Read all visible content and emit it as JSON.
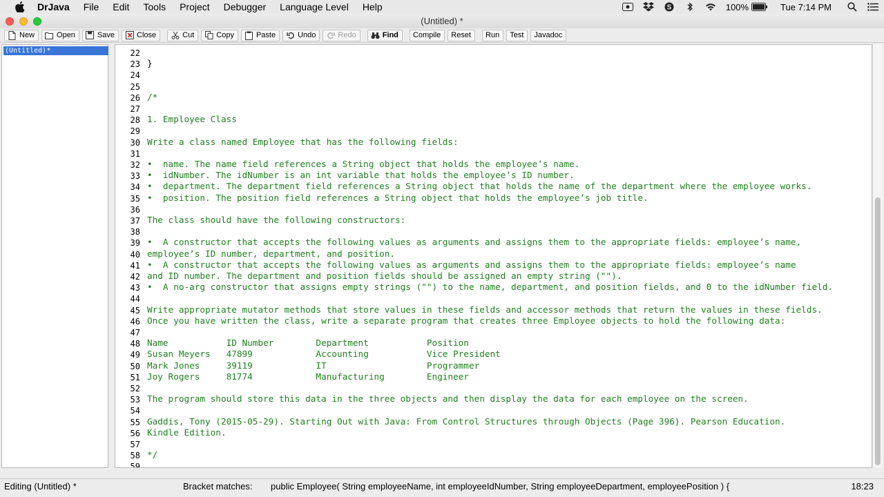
{
  "menubar": {
    "app_name": "DrJava",
    "items": [
      "File",
      "Edit",
      "Tools",
      "Project",
      "Debugger",
      "Language Level",
      "Help"
    ],
    "battery": "100%",
    "clock": "Tue 7:14 PM"
  },
  "window": {
    "title": "(Untitled) *"
  },
  "toolbar": {
    "new": "New",
    "open": "Open",
    "save": "Save",
    "close": "Close",
    "cut": "Cut",
    "copy": "Copy",
    "paste": "Paste",
    "undo": "Undo",
    "redo": "Redo",
    "find": "Find",
    "compile": "Compile",
    "reset": "Reset",
    "run": "Run",
    "test": "Test",
    "javadoc": "Javadoc"
  },
  "doclist": {
    "items": [
      "(Untitled)*"
    ]
  },
  "editor": {
    "lines": [
      {
        "n": "22",
        "t": "",
        "plain": true
      },
      {
        "n": "23",
        "t": "}",
        "plain": true
      },
      {
        "n": "24",
        "t": "",
        "plain": true
      },
      {
        "n": "25",
        "t": "",
        "plain": true
      },
      {
        "n": "26",
        "t": "/*"
      },
      {
        "n": "27",
        "t": ""
      },
      {
        "n": "28",
        "t": "1. Employee Class"
      },
      {
        "n": "29",
        "t": ""
      },
      {
        "n": "30",
        "t": "Write a class named Employee that has the following fields:"
      },
      {
        "n": "31",
        "t": ""
      },
      {
        "n": "32",
        "t": "•  name. The name field references a String object that holds the employee’s name."
      },
      {
        "n": "33",
        "t": "•  idNumber. The idNumber is an int variable that holds the employee’s ID number."
      },
      {
        "n": "34",
        "t": "•  department. The department field references a String object that holds the name of the department where the employee works."
      },
      {
        "n": "35",
        "t": "•  position. The position field references a String object that holds the employee’s job title."
      },
      {
        "n": "36",
        "t": ""
      },
      {
        "n": "37",
        "t": "The class should have the following constructors:"
      },
      {
        "n": "38",
        "t": ""
      },
      {
        "n": "39",
        "t": "•  A constructor that accepts the following values as arguments and assigns them to the appropriate fields: employee’s name,"
      },
      {
        "n": "40",
        "t": "employee’s ID number, department, and position."
      },
      {
        "n": "41",
        "t": "•  A constructor that accepts the following values as arguments and assigns them to the appropriate fields: employee’s name"
      },
      {
        "n": "42",
        "t": "and ID number. The department and position fields should be assigned an empty string (\"\")."
      },
      {
        "n": "43",
        "t": "•  A no-arg constructor that assigns empty strings (\"\") to the name, department, and position fields, and 0 to the idNumber field."
      },
      {
        "n": "44",
        "t": ""
      },
      {
        "n": "45",
        "t": "Write appropriate mutator methods that store values in these fields and accessor methods that return the values in these fields."
      },
      {
        "n": "46",
        "t": "Once you have written the class, write a separate program that creates three Employee objects to hold the following data:"
      },
      {
        "n": "47",
        "t": ""
      },
      {
        "n": "48",
        "t": "Name           ID Number        Department           Position"
      },
      {
        "n": "49",
        "t": "Susan Meyers   47899            Accounting           Vice President"
      },
      {
        "n": "50",
        "t": "Mark Jones     39119            IT                   Programmer"
      },
      {
        "n": "51",
        "t": "Joy Rogers     81774            Manufacturing        Engineer"
      },
      {
        "n": "52",
        "t": ""
      },
      {
        "n": "53",
        "t": "The program should store this data in the three objects and then display the data for each employee on the screen."
      },
      {
        "n": "54",
        "t": ""
      },
      {
        "n": "55",
        "t": "Gaddis, Tony (2015-05-29). Starting Out with Java: From Control Structures through Objects (Page 396). Pearson Education."
      },
      {
        "n": "56",
        "t": "Kindle Edition."
      },
      {
        "n": "57",
        "t": ""
      },
      {
        "n": "58",
        "t": "*/"
      },
      {
        "n": "59",
        "t": ""
      }
    ]
  },
  "statusbar": {
    "editing": "Editing (Untitled) *",
    "bracket_label": "Bracket matches:",
    "bracket_value": "public Employee( String employeeName, int employeeIdNumber, String employeeDepartment, employeePosition ) {",
    "cursor_pos": "18:23"
  }
}
